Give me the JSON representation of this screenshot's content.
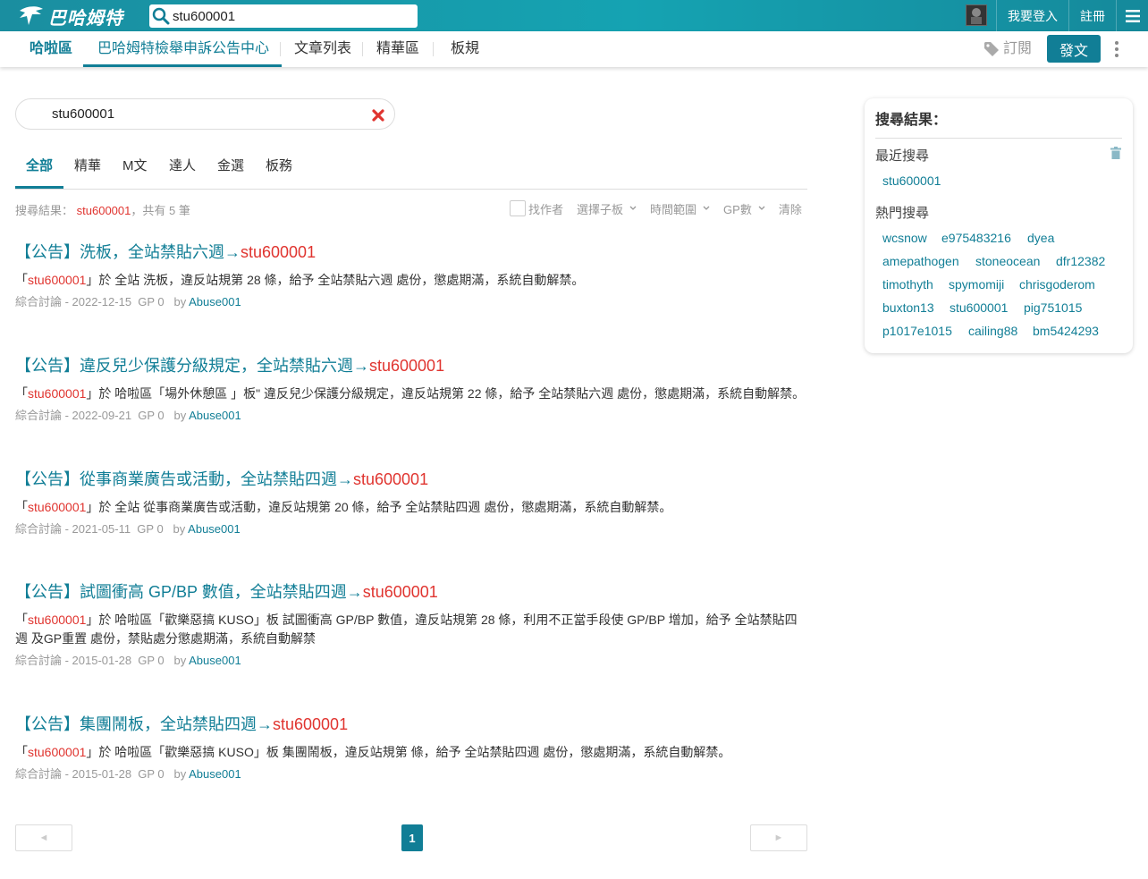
{
  "header": {
    "logo_text": "巴哈姆特",
    "search_value": "stu600001",
    "login_label": "我要登入",
    "register_label": "註冊"
  },
  "board_nav": {
    "items": [
      "哈啦區",
      "巴哈姆特檢舉申訴公告中心",
      "文章列表",
      "精華區",
      "板規"
    ],
    "subscribe_label": "訂閱",
    "post_label": "發文"
  },
  "search": {
    "value": "stu600001",
    "tabs": [
      "全部",
      "精華",
      "M文",
      "達人",
      "金選",
      "板務"
    ],
    "summary_prefix": "搜尋結果：",
    "summary_keyword": "stu600001",
    "summary_suffix": "，共有 5 筆",
    "filters": {
      "find_author": "找作者",
      "sub_board": "選擇子板",
      "time_range": "時間範圍",
      "gp": "GP數",
      "clear": "清除"
    }
  },
  "results": [
    {
      "title_prefix": "【公告】洗板，全站禁貼六週→",
      "title_kw": "stu600001",
      "desc_open": "「",
      "desc_kw": "stu600001",
      "desc_rest": "」於 全站 洗板，違反站規第 28 條，給予 全站禁貼六週 處份，懲處期滿，系統自動解禁。",
      "meta": "綜合討論 - 2022-12-15  GP 0   by ",
      "author": "Abuse001"
    },
    {
      "title_prefix": "【公告】違反兒少保護分級規定，全站禁貼六週→",
      "title_kw": "stu600001",
      "desc_open": "「",
      "desc_kw": "stu600001",
      "desc_rest": "」於 哈啦區「場外休憩區 」板\" 違反兒少保護分級規定，違反站規第 22 條，給予 全站禁貼六週 處份，懲處期滿，系統自動解禁。",
      "meta": "綜合討論 - 2022-09-21  GP 0   by ",
      "author": "Abuse001"
    },
    {
      "title_prefix": "【公告】從事商業廣告或活動，全站禁貼四週→",
      "title_kw": "stu600001",
      "desc_open": "「",
      "desc_kw": "stu600001",
      "desc_rest": "」於 全站 從事商業廣告或活動，違反站規第 20 條，給予 全站禁貼四週 處份，懲處期滿，系統自動解禁。",
      "meta": "綜合討論 - 2021-05-11  GP 0   by ",
      "author": "Abuse001"
    },
    {
      "title_prefix": "【公告】試圖衝高 GP/BP 數值，全站禁貼四週→",
      "title_kw": "stu600001",
      "desc_open": "「",
      "desc_kw": "stu600001",
      "desc_rest": "」於 哈啦區「歡樂惡搞 KUSO」板 試圖衝高 GP/BP 數值，違反站規第 28 條，利用不正當手段使 GP/BP 增加，給予 全站禁貼四週 及GP重置 處份，禁貼處分懲處期滿，系統自動解禁",
      "meta": "綜合討論 - 2015-01-28  GP 0   by ",
      "author": "Abuse001"
    },
    {
      "title_prefix": "【公告】集團鬧板，全站禁貼四週→",
      "title_kw": "stu600001",
      "desc_open": "「",
      "desc_kw": "stu600001",
      "desc_rest": "」於 哈啦區「歡樂惡搞 KUSO」板 集團鬧板，違反站規第 條，給予 全站禁貼四週 處份，懲處期滿，系統自動解禁。",
      "meta": "綜合討論 - 2015-01-28  GP 0   by ",
      "author": "Abuse001"
    }
  ],
  "pagination": {
    "prev": "◄",
    "current": "1",
    "next": "►"
  },
  "sidebar": {
    "heading": "搜尋結果：",
    "recent_label": "最近搜尋",
    "recent": [
      "stu600001"
    ],
    "hot_label": "熱門搜尋",
    "hot": [
      "wcsnow",
      "e975483216",
      "dyea",
      "amepathogen",
      "stoneocean",
      "dfr12382",
      "timothyth",
      "spymomiji",
      "chrisgoderom",
      "buxton13",
      "stu600001",
      "pig751015",
      "p1017e1015",
      "cailing88",
      "bm5424293"
    ]
  },
  "colors": {
    "accent": "#117e96",
    "keyword": "#e0342f",
    "header": "#15a3b2"
  }
}
